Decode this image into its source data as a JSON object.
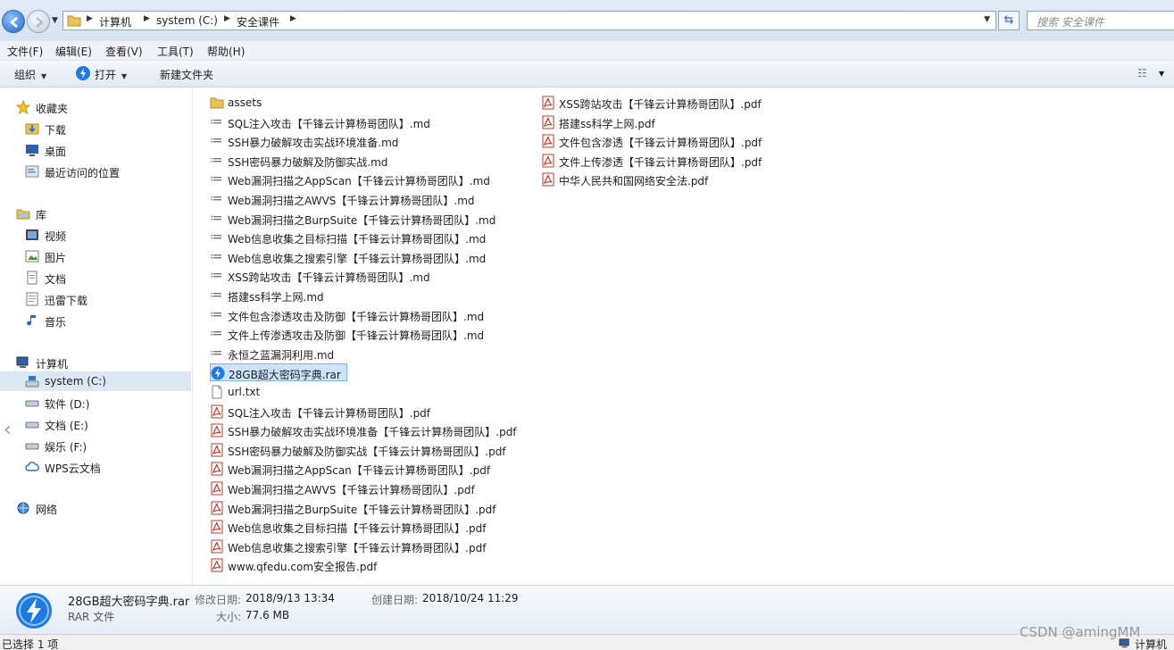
{
  "address": {
    "breadcrumbs": [
      "计算机",
      "system (C:)",
      "安全课件"
    ],
    "search_placeholder": "搜索 安全课件"
  },
  "menu": [
    "文件(F)",
    "编辑(E)",
    "查看(V)",
    "工具(T)",
    "帮助(H)"
  ],
  "toolbar": {
    "organize": "组织",
    "open": "打开",
    "new_folder": "新建文件夹"
  },
  "nav": {
    "favorites": "收藏夹",
    "downloads": "下载",
    "desktop": "桌面",
    "recent": "最近访问的位置",
    "libraries": "库",
    "videos": "视频",
    "pictures": "图片",
    "documents": "文档",
    "xunlei": "迅雷下载",
    "music": "音乐",
    "computer": "计算机",
    "drive_c": "system (C:)",
    "drive_d": "软件 (D:)",
    "drive_e": "文档 (E:)",
    "drive_f": "娱乐 (F:)",
    "wps": "WPS云文档",
    "network": "网络"
  },
  "files_col1": [
    {
      "name": "assets",
      "type": "folder"
    },
    {
      "name": "SQL注入攻击【千锋云计算杨哥团队】.md",
      "type": "md"
    },
    {
      "name": "SSH暴力破解攻击实战环境准备.md",
      "type": "md"
    },
    {
      "name": "SSH密码暴力破解及防御实战.md",
      "type": "md"
    },
    {
      "name": "Web漏洞扫描之AppScan【千锋云计算杨哥团队】.md",
      "type": "md"
    },
    {
      "name": "Web漏洞扫描之AWVS【千锋云计算杨哥团队】.md",
      "type": "md"
    },
    {
      "name": "Web漏洞扫描之BurpSuite【千锋云计算杨哥团队】.md",
      "type": "md"
    },
    {
      "name": "Web信息收集之目标扫描【千锋云计算杨哥团队】.md",
      "type": "md"
    },
    {
      "name": "Web信息收集之搜索引擎【千锋云计算杨哥团队】.md",
      "type": "md"
    },
    {
      "name": "XSS跨站攻击【千锋云计算杨哥团队】.md",
      "type": "md"
    },
    {
      "name": "搭建ss科学上网.md",
      "type": "md"
    },
    {
      "name": "文件包含渗透攻击及防御【千锋云计算杨哥团队】.md",
      "type": "md"
    },
    {
      "name": "文件上传渗透攻击及防御【千锋云计算杨哥团队】.md",
      "type": "md"
    },
    {
      "name": "永恒之蓝漏洞利用.md",
      "type": "md"
    },
    {
      "name": "28GB超大密码字典.rar",
      "type": "rar",
      "selected": true
    },
    {
      "name": "url.txt",
      "type": "txt"
    },
    {
      "name": "SQL注入攻击【千锋云计算杨哥团队】.pdf",
      "type": "pdf"
    },
    {
      "name": "SSH暴力破解攻击实战环境准备【千锋云计算杨哥团队】.pdf",
      "type": "pdf"
    },
    {
      "name": "SSH密码暴力破解及防御实战【千锋云计算杨哥团队】.pdf",
      "type": "pdf"
    },
    {
      "name": "Web漏洞扫描之AppScan【千锋云计算杨哥团队】.pdf",
      "type": "pdf"
    },
    {
      "name": "Web漏洞扫描之AWVS【千锋云计算杨哥团队】.pdf",
      "type": "pdf"
    },
    {
      "name": "Web漏洞扫描之BurpSuite【千锋云计算杨哥团队】.pdf",
      "type": "pdf"
    },
    {
      "name": "Web信息收集之目标扫描【千锋云计算杨哥团队】.pdf",
      "type": "pdf"
    },
    {
      "name": "Web信息收集之搜索引擎【千锋云计算杨哥团队】.pdf",
      "type": "pdf"
    },
    {
      "name": "www.qfedu.com安全报告.pdf",
      "type": "pdf"
    }
  ],
  "files_col2": [
    {
      "name": "XSS跨站攻击【千锋云计算杨哥团队】.pdf",
      "type": "pdf"
    },
    {
      "name": "搭建ss科学上网.pdf",
      "type": "pdf"
    },
    {
      "name": "文件包含渗透【千锋云计算杨哥团队】.pdf",
      "type": "pdf"
    },
    {
      "name": "文件上传渗透【千锋云计算杨哥团队】.pdf",
      "type": "pdf"
    },
    {
      "name": "中华人民共和国网络安全法.pdf",
      "type": "pdf"
    }
  ],
  "details": {
    "name": "28GB超大密码字典.rar",
    "type": "RAR 文件",
    "modified_label": "修改日期:",
    "modified": "2018/9/13 13:34",
    "created_label": "创建日期:",
    "created": "2018/10/24 11:29",
    "size_label": "大小:",
    "size": "77.6 MB"
  },
  "status": {
    "selected": "已选择 1 项",
    "right": "计算机"
  },
  "watermark": "CSDN @amingMM"
}
